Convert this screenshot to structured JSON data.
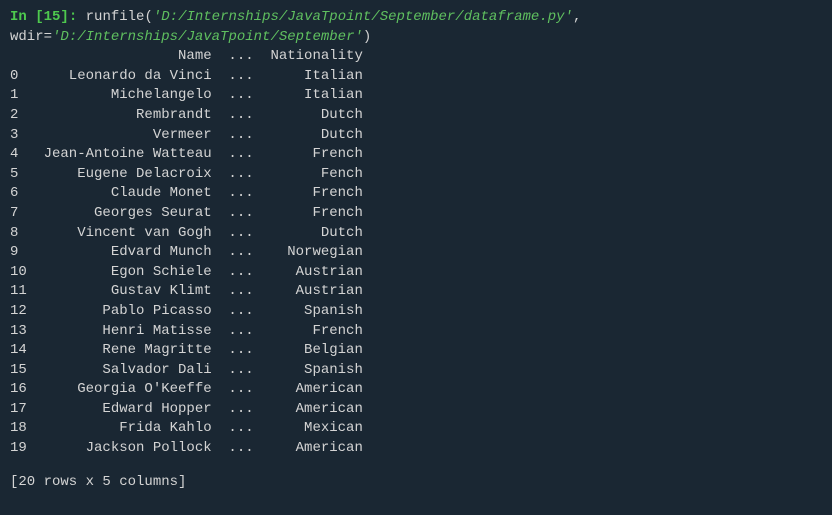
{
  "prompt": {
    "in_label": "In [",
    "num": "15",
    "close": "]: "
  },
  "command": {
    "func": "runfile",
    "open_paren": "(",
    "arg1": "'D:/Internships/JavaTpoint/September/dataframe.py'",
    "sep": ", ",
    "kwarg": "wdir",
    "eq": "=",
    "arg2": "'D:/Internships/JavaTpoint/September'",
    "close_paren": ")"
  },
  "header": "                    Name  ...  Nationality",
  "rows": [
    "0      Leonardo da Vinci  ...      Italian",
    "1           Michelangelo  ...      Italian",
    "2              Rembrandt  ...        Dutch",
    "3                Vermeer  ...        Dutch",
    "4   Jean-Antoine Watteau  ...       French",
    "5       Eugene Delacroix  ...        Fench",
    "6           Claude Monet  ...       French",
    "7         Georges Seurat  ...       French",
    "8       Vincent van Gogh  ...        Dutch",
    "9           Edvard Munch  ...    Norwegian",
    "10          Egon Schiele  ...     Austrian",
    "11          Gustav Klimt  ...     Austrian",
    "12         Pablo Picasso  ...      Spanish",
    "13         Henri Matisse  ...       French",
    "14         Rene Magritte  ...      Belgian",
    "15         Salvador Dali  ...      Spanish",
    "16      Georgia O'Keeffe  ...     American",
    "17         Edward Hopper  ...     American",
    "18           Frida Kahlo  ...      Mexican",
    "19       Jackson Pollock  ...     American"
  ],
  "summary": "[20 rows x 5 columns]"
}
